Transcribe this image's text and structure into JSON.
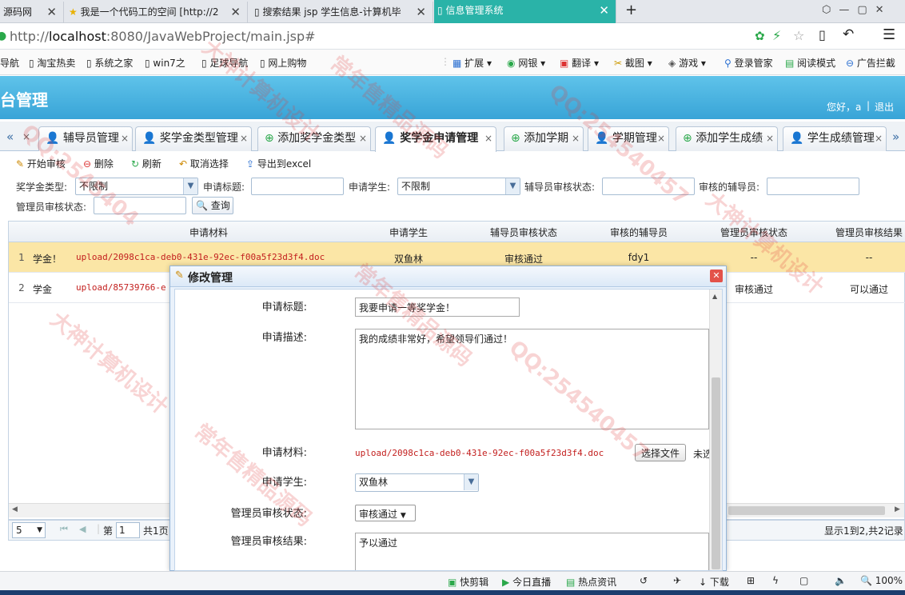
{
  "browser": {
    "tabs": [
      {
        "title": "源码网",
        "active": false
      },
      {
        "title": "我是一个代码工的空间 [http://2",
        "active": false
      },
      {
        "title": "搜索结果 jsp 学生信息-计算机毕",
        "active": false
      },
      {
        "title": "信息管理系统",
        "active": true
      }
    ],
    "new_tab": "+",
    "url_prefix": "http://",
    "url_host": "localhost",
    "url_rest": ":8080/JavaWebProject/main.jsp#",
    "bookmarks": [
      "导航",
      "淘宝热卖",
      "系统之家",
      "win7之",
      "足球导航",
      "网上购物"
    ],
    "bookmark_tools": [
      "扩展",
      "网银",
      "翻译",
      "截图",
      "游戏",
      "登录管家",
      "阅读模式",
      "广告拦截"
    ]
  },
  "app": {
    "header_title": "台管理",
    "greeting": "您好，a",
    "logout": "退出",
    "header_color": "#3aa6d8"
  },
  "page_tabs": [
    {
      "label": "辅导员管理"
    },
    {
      "label": "奖学金类型管理"
    },
    {
      "label": "添加奖学金类型"
    },
    {
      "label": "奖学金申请管理"
    },
    {
      "label": "添加学期"
    },
    {
      "label": "学期管理"
    },
    {
      "label": "添加学生成绩"
    },
    {
      "label": "学生成绩管理"
    }
  ],
  "toolbar": {
    "start_review": "开始审核",
    "delete": "删除",
    "refresh": "刷新",
    "cancel_select": "取消选择",
    "export": "导出到excel"
  },
  "search": {
    "type_label": "奖学金类型:",
    "type_value": "不限制",
    "title_label": "申请标题:",
    "student_label": "申请学生:",
    "student_value": "不限制",
    "counselor_status_label": "辅导员审核状态:",
    "counselor_label": "审核的辅导员:",
    "admin_status_label": "管理员审核状态:",
    "query": "查询"
  },
  "grid": {
    "columns": [
      "申请材料",
      "申请学生",
      "辅导员审核状态",
      "审核的辅导员",
      "管理员审核状态",
      "管理员审核结果"
    ],
    "rows": [
      {
        "num": "1",
        "title": "学金！",
        "file": "upload/2098c1ca-deb0-431e-92ec-f00a5f23d3f4.doc",
        "student": "双鱼林",
        "counselor_status": "审核通过",
        "counselor": "fdy1",
        "admin_status": "--",
        "admin_result": "--"
      },
      {
        "num": "2",
        "title": "学金",
        "file": "upload/85739766-e",
        "student": "",
        "counselor_status": "",
        "counselor": "",
        "admin_status": "审核通过",
        "admin_result": "可以通过"
      }
    ]
  },
  "pager": {
    "page_size": "5",
    "page_label": "第",
    "page_value": "1",
    "total": "共1页",
    "summary": "显示1到2,共2记录"
  },
  "dialog": {
    "title": "修改管理",
    "apply_title_label": "申请标题:",
    "apply_title_value": "我要申请一等奖学金！",
    "desc_label": "申请描述:",
    "desc_value": "我的成绩非常好，希望领导们通过！",
    "file_label": "申请材料:",
    "file_value": "upload/2098c1ca-deb0-431e-92ec-f00a5f23d3f4.doc",
    "choose_file": "选择文件",
    "no_file": "未选",
    "student_label": "申请学生:",
    "student_value": "双鱼林",
    "admin_status_label": "管理员审核状态:",
    "admin_status_value": "审核通过",
    "admin_result_label": "管理员审核结果:",
    "admin_result_value": "予以通过"
  },
  "status_bar": {
    "items": [
      "快剪辑",
      "今日直播",
      "热点资讯",
      "下载"
    ],
    "zoom": "100%"
  },
  "watermarks": [
    "QQ:2545404",
    "大神计算机设计",
    "常年售精品源码",
    "QQ:254540457",
    "大神计算机设计",
    "常年售精品源码",
    "QQ:254540457",
    "大神计算机设计",
    "常年售精品源码"
  ]
}
